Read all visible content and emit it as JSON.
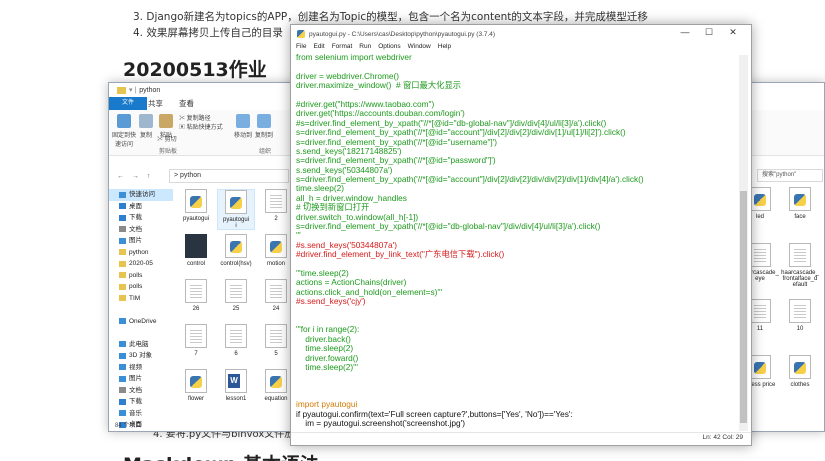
{
  "document": {
    "list_items": [
      "3. Django新建名为topics的APP，创建名为Topic的模型，包含一个名为content的文本字段，并完成模型迁移",
      "4. 效果屏幕拷贝上传自己的目录"
    ],
    "heading": "20200513作业",
    "bottom_text": "4. 要将.py文件与binvox文件放",
    "bottom_heading": "Maskdown 基本语法"
  },
  "explorer": {
    "title": "python",
    "tabs": [
      "文件",
      "主页",
      "共享",
      "查看"
    ],
    "ribbon": {
      "pin_label": "固定到快速访问",
      "copy_label": "复制",
      "paste_label": "粘贴",
      "copy_path_label": "复制路径",
      "paste_shortcut_label": "粘贴快捷方式",
      "cut_label": "剪切",
      "move_to_label": "移动到",
      "copy_to_label": "复制到",
      "clipboard_group": "剪贴板",
      "organize_group": "组织"
    },
    "address": {
      "nav": "← → ↑",
      "path": "> python",
      "search_placeholder": "搜索\"python\""
    },
    "sidebar": [
      {
        "label": "快速访问",
        "color": "#3d8fd8",
        "selected": true
      },
      {
        "label": "桌面",
        "color": "#2f7fd0",
        "selected": false
      },
      {
        "label": "下载",
        "color": "#2f7fd0",
        "selected": false
      },
      {
        "label": "文档",
        "color": "#8a8a8a",
        "selected": false
      },
      {
        "label": "图片",
        "color": "#3a8fd6",
        "selected": false
      },
      {
        "label": "python",
        "color": "#e7c34f",
        "selected": false
      },
      {
        "label": "2020-05",
        "color": "#e7c34f",
        "selected": false
      },
      {
        "label": "polls",
        "color": "#e7c34f",
        "selected": false
      },
      {
        "label": "polls",
        "color": "#e7c34f",
        "selected": false
      },
      {
        "label": "TIM",
        "color": "#e7c34f",
        "selected": false
      },
      {
        "label": "",
        "color": "",
        "selected": false
      },
      {
        "label": "OneDrive",
        "color": "#3a8fd6",
        "selected": false
      },
      {
        "label": "",
        "color": "",
        "selected": false
      },
      {
        "label": "此电脑",
        "color": "#3a8fd6",
        "selected": false
      },
      {
        "label": "3D 对象",
        "color": "#3a8fd6",
        "selected": false
      },
      {
        "label": "视频",
        "color": "#3a8fd6",
        "selected": false
      },
      {
        "label": "图片",
        "color": "#3a8fd6",
        "selected": false
      },
      {
        "label": "文档",
        "color": "#8a8a8a",
        "selected": false
      },
      {
        "label": "下载",
        "color": "#2f7fd0",
        "selected": false
      },
      {
        "label": "音乐",
        "color": "#3a8fd6",
        "selected": false
      },
      {
        "label": "桌面",
        "color": "#2f7fd0",
        "selected": false
      }
    ],
    "status": "84 个项目",
    "files": [
      {
        "label": "pyautogui",
        "kind": "py",
        "selected": false
      },
      {
        "label": "pyautogui\ni",
        "kind": "py",
        "selected": true
      },
      {
        "label": "2",
        "kind": "txt",
        "selected": false
      },
      {
        "label": "control",
        "kind": "img",
        "selected": false
      },
      {
        "label": "control(hsv)",
        "kind": "py",
        "selected": false
      },
      {
        "label": "motion",
        "kind": "py",
        "selected": false
      },
      {
        "label": "26",
        "kind": "txt",
        "selected": false
      },
      {
        "label": "25",
        "kind": "txt",
        "selected": false
      },
      {
        "label": "24",
        "kind": "txt",
        "selected": false
      },
      {
        "label": "7",
        "kind": "txt",
        "selected": false
      },
      {
        "label": "6",
        "kind": "txt",
        "selected": false
      },
      {
        "label": "5",
        "kind": "txt",
        "selected": false
      },
      {
        "label": "flower",
        "kind": "py",
        "selected": false
      },
      {
        "label": "lesson1",
        "kind": "word",
        "selected": false
      },
      {
        "label": "equation",
        "kind": "py",
        "selected": false
      }
    ],
    "right_files": [
      {
        "label": "led",
        "kind": "py"
      },
      {
        "label": "face",
        "kind": "py"
      },
      {
        "label": "haarcascade_eye",
        "kind": "txt"
      },
      {
        "label": "haarcascade_frontalface_default",
        "kind": "txt"
      },
      {
        "label": "11",
        "kind": "txt"
      },
      {
        "label": "10",
        "kind": "txt"
      },
      {
        "label": "guess price",
        "kind": "py"
      },
      {
        "label": "clothes",
        "kind": "py"
      }
    ]
  },
  "idle": {
    "title": "pyautogui.py - C:\\Users\\cas\\Desktop\\python\\pyautogui.py (3.7.4)",
    "window_buttons": [
      "—",
      "☐",
      "✕"
    ],
    "menu": [
      "File",
      "Edit",
      "Format",
      "Run",
      "Options",
      "Window",
      "Help"
    ],
    "status": "Ln: 42  Col: 29",
    "code_lines": [
      {
        "c": "green",
        "t": "from selenium import webdriver"
      },
      {
        "c": "black",
        "t": ""
      },
      {
        "c": "green",
        "t": "driver = webdriver.Chrome()"
      },
      {
        "c": "green",
        "t": "driver.maximize_window()  # 窗口最大化显示"
      },
      {
        "c": "black",
        "t": ""
      },
      {
        "c": "green",
        "t": "#driver.get(\"https://www.taobao.com\")"
      },
      {
        "c": "green",
        "t": "driver.get('https://accounts.douban.com/login')"
      },
      {
        "c": "green",
        "t": "#s=driver.find_element_by_xpath(\"//*[@id=\"db-global-nav\"]/div/div[4]/ul/li[3]/a').click()"
      },
      {
        "c": "green",
        "t": "s=driver.find_element_by_xpath('//*[@id=\"account\"]/div[2]/div[2]/div/div[1]/ul[1]/li[2]').click()"
      },
      {
        "c": "green",
        "t": "s=driver.find_element_by_xpath('//*[@id=\"username\"]')"
      },
      {
        "c": "green",
        "t": "s.send_keys('18217148825')"
      },
      {
        "c": "green",
        "t": "s=driver.find_element_by_xpath('//*[@id=\"password\"]')"
      },
      {
        "c": "green",
        "t": "s.send_keys('50344807a')"
      },
      {
        "c": "green",
        "t": "s=driver.find_element_by_xpath('//*[@id=\"account\"]/div[2]/div[2]/div/div[2]/div[1]/div[4]/a').click()"
      },
      {
        "c": "green",
        "t": "time.sleep(2)"
      },
      {
        "c": "green",
        "t": "all_h = driver.window_handles"
      },
      {
        "c": "green",
        "t": "# 切换到新窗口打开"
      },
      {
        "c": "green",
        "t": "driver.switch_to.window(all_h[-1])"
      },
      {
        "c": "green",
        "t": "s=driver.find_element_by_xpath('//*[@id=\"db-global-nav\"]/div/div[4]/ul/li[3]/a').click()"
      },
      {
        "c": "green",
        "t": "'''"
      },
      {
        "c": "red",
        "t": "#s.send_keys('50344807a')"
      },
      {
        "c": "red",
        "t": "#driver.find_element_by_link_text(\"广东电信下载\").click()"
      },
      {
        "c": "black",
        "t": ""
      },
      {
        "c": "green",
        "t": "'''time.sleep(2)"
      },
      {
        "c": "green",
        "t": "actions = ActionChains(driver)"
      },
      {
        "c": "green",
        "t": "actions.click_and_hold(on_element=s)'''"
      },
      {
        "c": "red",
        "t": "#s.send_keys('cjy')"
      },
      {
        "c": "black",
        "t": ""
      },
      {
        "c": "black",
        "t": ""
      },
      {
        "c": "green",
        "t": "'''for i in range(2):"
      },
      {
        "c": "green",
        "t": "    driver.back()"
      },
      {
        "c": "green",
        "t": "    time.sleep(2)"
      },
      {
        "c": "green",
        "t": "    driver.foward()"
      },
      {
        "c": "green",
        "t": "    time.sleep(2)'''"
      },
      {
        "c": "black",
        "t": ""
      },
      {
        "c": "black",
        "t": ""
      },
      {
        "c": "black",
        "t": ""
      },
      {
        "c": "orange",
        "t": "import pyautogui"
      },
      {
        "c": "black",
        "t": "if pyautogui.confirm(text='Full screen capture?',buttons=['Yes', 'No'])=='Yes':"
      },
      {
        "c": "black",
        "t": "    im = pyautogui.screenshot('screenshot.jpg')"
      }
    ]
  }
}
